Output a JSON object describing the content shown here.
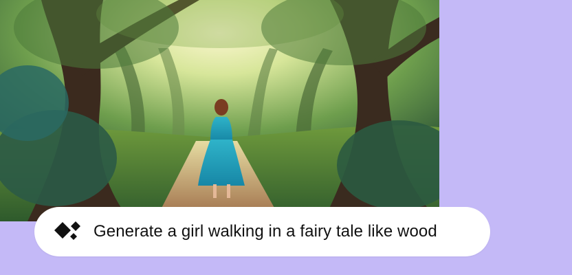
{
  "hero_image": {
    "icon": "fairy-tale-forest-image"
  },
  "prompt": {
    "icon": "ai-sparkle-icon",
    "text": "Generate a girl walking in a fairy tale like wood"
  },
  "colors": {
    "background": "#c4b9f7",
    "pill": "#ffffff",
    "text": "#111111"
  }
}
